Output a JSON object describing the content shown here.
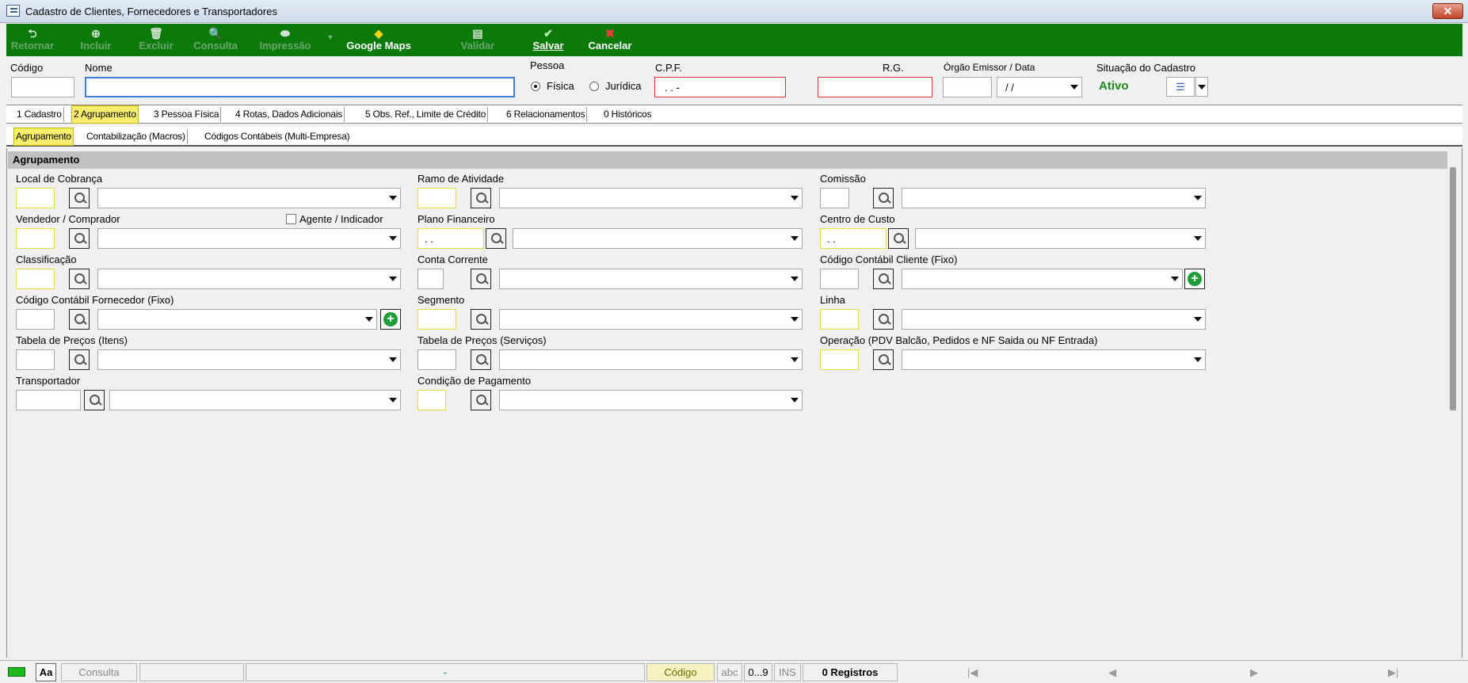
{
  "window": {
    "title": "Cadastro de Clientes, Fornecedores e Transportadores",
    "close": "✕"
  },
  "toolbar": {
    "retornar": "Retornar",
    "incluir": "Incluir",
    "excluir": "Excluir",
    "consulta": "Consulta",
    "impressao": "Impressão",
    "google_maps": "Google Maps",
    "validar": "Validar",
    "salvar": "Salvar",
    "cancelar": "Cancelar"
  },
  "header": {
    "codigo_label": "Código",
    "codigo_value": "",
    "nome_label": "Nome",
    "nome_value": "",
    "pessoa_label": "Pessoa",
    "fisica": "Física",
    "juridica": "Jurídica",
    "pessoa_selected": "Física",
    "cpf_label": "C.P.F.",
    "cpf_value": ". . -",
    "rg_label": "R.G.",
    "rg_value": "",
    "orgao_label": "Órgão Emissor  / Data",
    "orgao_value": "",
    "data_value": "/ /",
    "situacao_label": "Situação do Cadastro",
    "situacao_value": "Ativo"
  },
  "tabs": [
    {
      "label": "1 Cadastro"
    },
    {
      "label": "2 Agrupamento"
    },
    {
      "label": "3 Pessoa Física"
    },
    {
      "label": "4 Rotas, Dados Adicionais"
    },
    {
      "label": "5 Obs. Ref., Limite de Crédito"
    },
    {
      "label": "6 Relacionamentos"
    },
    {
      "label": "0 Históricos"
    }
  ],
  "subtabs": [
    {
      "label": "Agrupamento"
    },
    {
      "label": "Contabilização (Macros)"
    },
    {
      "label": "Códigos Contábeis (Multi-Empresa)"
    }
  ],
  "section": {
    "title": "Agrupamento"
  },
  "fields": {
    "local_cobranca": "Local de Cobrança",
    "vendedor": "Vendedor / Comprador",
    "agente": "Agente / Indicador",
    "classificacao": "Classificação",
    "cod_contabil_fornecedor": "Código Contábil Fornecedor (Fixo)",
    "tabela_itens": "Tabela de Preços (Itens)",
    "transportador": "Transportador",
    "ramo": "Ramo de Atividade",
    "plano": "Plano Financeiro",
    "plano_value": ". .",
    "conta_corrente": "Conta Corrente",
    "segmento": "Segmento",
    "tabela_servicos": "Tabela de Preços (Serviços)",
    "condicao": "Condição de Pagamento",
    "comissao": "Comissão",
    "centro_custo": "Centro de Custo",
    "centro_value": ". .",
    "cod_contabil_cliente": "Código Contábil Cliente (Fixo)",
    "linha": "Linha",
    "operacao": "Operação (PDV Balcão, Pedidos e NF Saida ou NF Entrada)"
  },
  "status": {
    "aa": "Aa",
    "mode": "Consulta",
    "center": "-",
    "codigo": "Código",
    "abc": "abc",
    "num": "0...9",
    "ins": "INS",
    "registros": "0 Registros",
    "first": "|◀",
    "prev": "◀",
    "next": "▶",
    "last": "▶|"
  },
  "colors": {
    "toolbar": "#0b7a0b",
    "active_tab": "#f7ee6e",
    "status_ativo": "#1a8a1a",
    "required_border": "#e23030"
  }
}
